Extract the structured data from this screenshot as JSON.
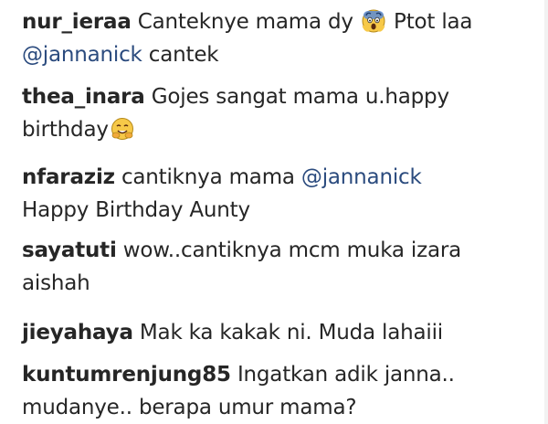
{
  "comments": [
    {
      "username": "nur_ieraa",
      "text_a": "Canteknye mama dy",
      "emoji": "face-screaming-in-fear-icon",
      "text_b": "Ptot laa",
      "mention": "@jannanick",
      "text_c": "cantek"
    },
    {
      "username": "thea_inara",
      "text_a": "Gojes sangat mama u.happy",
      "text_b": "birthday",
      "emoji": "hugging-face-icon"
    },
    {
      "username": "nfaraziz",
      "text_a": "cantiknya mama",
      "mention": "@jannanick",
      "text_b": "Happy Birthday Aunty"
    },
    {
      "username": "sayatuti",
      "text_a": "wow..cantiknya mcm muka izara",
      "text_b": "aishah"
    },
    {
      "username": "jieyahaya",
      "text_a": "Mak ka kakak ni. Muda lahaiii"
    },
    {
      "username": "kuntumrenjung85",
      "text_a": "Ingatkan adik janna..",
      "text_b": "mudanye.. berapa umur mama?"
    }
  ]
}
